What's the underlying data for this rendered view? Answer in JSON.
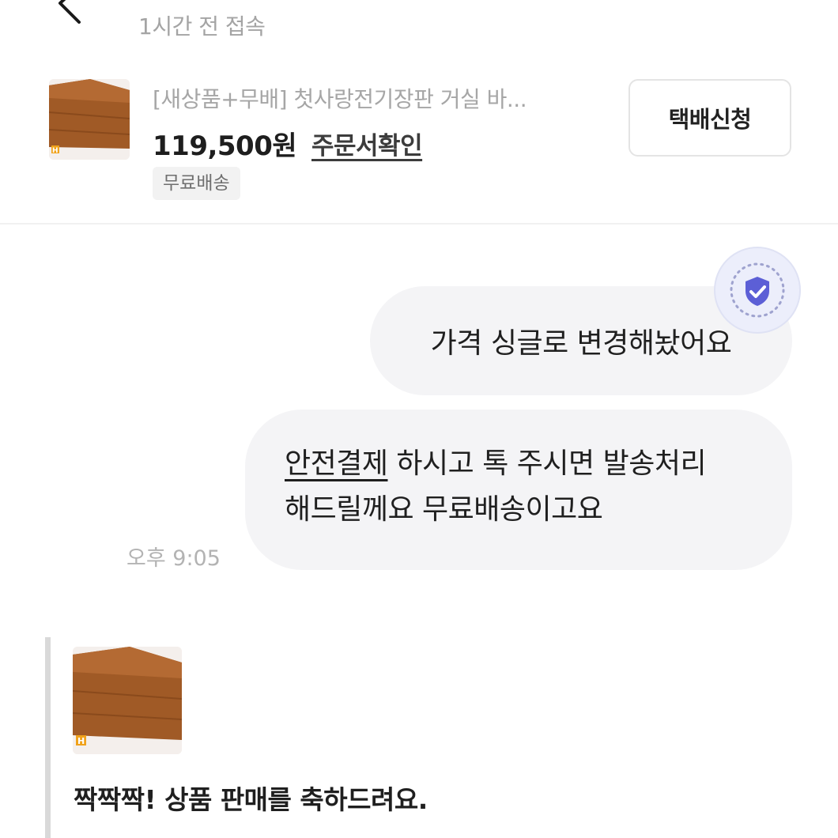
{
  "header": {
    "status": "1시간 전 접속"
  },
  "product": {
    "title": "[새상품+무배] 첫사랑전기장판 거실 바...",
    "price": "119,500원",
    "order_check_link": "주문서확인",
    "badge": "무료배송",
    "shipping_button": "택배신청",
    "thumbnail_icon": "product-photo-heated-mat",
    "thumbnail_mark": "H"
  },
  "chat": {
    "messages": [
      {
        "text": "가격 싱글로 변경해놨어요"
      },
      {
        "link": "안전결제",
        "rest_line1": " 하시고 톡 주시면 발송처리",
        "line2": "해드릴께요 무료배송이고요"
      }
    ],
    "time": "오후 9:05",
    "badge_icon": "shield-check-icon"
  },
  "system_card": {
    "text": "짝짝짝! 상품 판매를 축하드려요.",
    "thumbnail_mark": "H"
  },
  "colors": {
    "bubble_bg": "#f4f4f6",
    "shield": "#5c5fd6",
    "muted_text": "#a6a6a6"
  }
}
